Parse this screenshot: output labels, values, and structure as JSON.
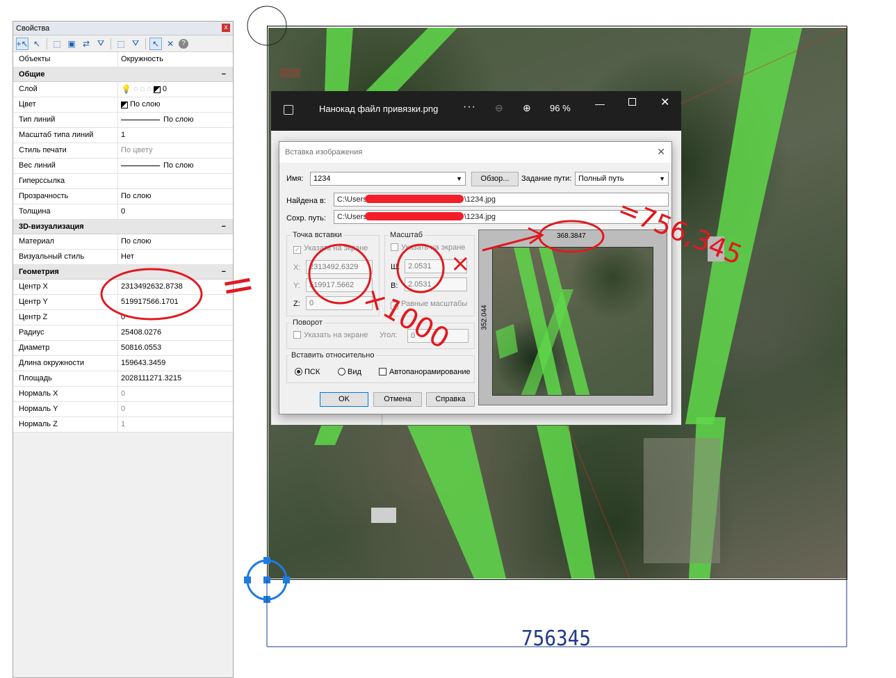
{
  "properties": {
    "title": "Свойства",
    "close_label": "x",
    "objects_label": "Объекты",
    "objects_value": "Окружность",
    "categories": {
      "general": "Общие",
      "viz3d": "3D-визуализация",
      "geometry": "Геометрия"
    },
    "general_rows": [
      {
        "key": "Слой",
        "value": "0"
      },
      {
        "key": "Цвет",
        "value": "По слою"
      },
      {
        "key": "Тип линий",
        "value": "По слою"
      },
      {
        "key": "Масштаб типа линий",
        "value": "1"
      },
      {
        "key": "Стиль печати",
        "value": "По цвету"
      },
      {
        "key": "Вес линий",
        "value": "По слою"
      },
      {
        "key": "Гиперссылка",
        "value": ""
      },
      {
        "key": "Прозрачность",
        "value": "По слою"
      },
      {
        "key": "Толщина",
        "value": "0"
      }
    ],
    "viz_rows": [
      {
        "key": "Материал",
        "value": "По слою"
      },
      {
        "key": "Визуальный стиль",
        "value": "Нет"
      }
    ],
    "geometry_rows": [
      {
        "key": "Центр X",
        "value": "2313492632.8738"
      },
      {
        "key": "Центр Y",
        "value": "519917566.1701"
      },
      {
        "key": "Центр Z",
        "value": "0"
      },
      {
        "key": "Радиус",
        "value": "25408.0276"
      },
      {
        "key": "Диаметр",
        "value": "50816.0553"
      },
      {
        "key": "Длина окружности",
        "value": "159643.3459"
      },
      {
        "key": "Площадь",
        "value": "2028111271.3215"
      },
      {
        "key": "Нормаль X",
        "value": "0"
      },
      {
        "key": "Нормаль Y",
        "value": "0"
      },
      {
        "key": "Нормаль Z",
        "value": "1"
      }
    ]
  },
  "viewer": {
    "filename": "Нанокад файл привязки.png",
    "dots": "···",
    "zoom": "96 %",
    "minimize": "—",
    "close": "✕"
  },
  "dialog": {
    "title": "Вставка изображения",
    "close": "✕",
    "name_label": "Имя:",
    "name_value": "1234",
    "browse_button": "Обзор...",
    "path_type_label": "Задание пути:",
    "path_type_value": "Полный путь",
    "found_label": "Найдена в:",
    "found_prefix": "C:\\Users",
    "found_suffix": "\\1234.jpg",
    "saved_label": "Сохр. путь:",
    "saved_prefix": "C:\\Users",
    "saved_suffix": "\\1234.jpg",
    "insert_point": {
      "title": "Точка вставки",
      "specify": "Указать на экране",
      "x_label": "X:",
      "x_value": "2313492.6329",
      "y_label": "Y:",
      "y_value": "519917.5662",
      "z_label": "Z:",
      "z_value": "0"
    },
    "scale": {
      "title": "Масштаб",
      "specify": "Указать на экране",
      "w_label": "Ш:",
      "w_value": "2.0531",
      "h_label": "В:",
      "h_value": "2.0531",
      "equal": "Равные масштабы"
    },
    "rotation": {
      "title": "Поворот",
      "specify": "Указать на экране",
      "angle_label": "Угол:",
      "angle_value": "0"
    },
    "insert_relative": {
      "title": "Вставить относительно",
      "ucs": "ПСК",
      "view": "Вид",
      "autopan": "Автопанорамирование"
    },
    "ok": "OK",
    "cancel": "Отмена",
    "help": "Справка",
    "preview_width": "368.3847",
    "preview_height": "352.044"
  },
  "drawing": {
    "dimension_value": "756345"
  },
  "annotations": {
    "equals": "=",
    "times_1000": "×1000",
    "times": "×",
    "arrow": "→",
    "result": "=756,345"
  },
  "colors": {
    "annotation_red": "#e0191f",
    "corridor_green": "#5fd84a",
    "selection_blue": "#1e7be0"
  }
}
